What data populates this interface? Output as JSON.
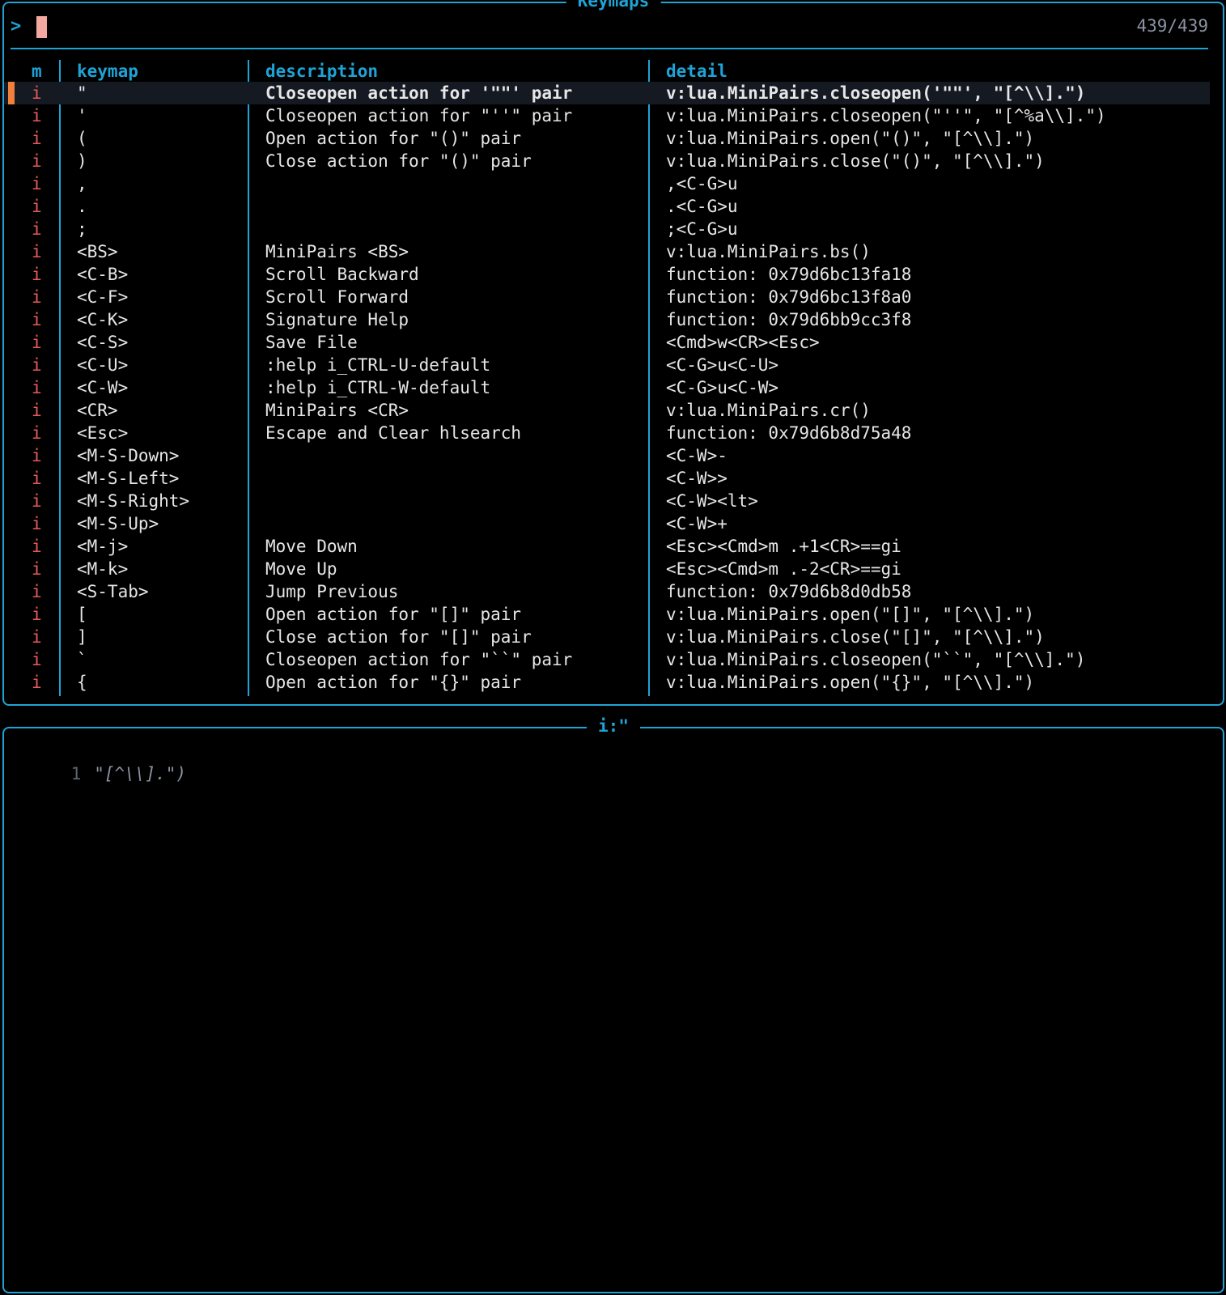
{
  "picker": {
    "title": "Keymaps",
    "prompt_symbol": ">",
    "query": "",
    "counter": "439/439",
    "columns": {
      "mode": "m",
      "keymap": "keymap",
      "description": "description",
      "detail": "detail"
    },
    "rows": [
      {
        "mode": "i",
        "keymap": "\"",
        "description": "Closeopen action for '\"\"' pair",
        "detail": "v:lua.MiniPairs.closeopen('\"\"', \"[^\\\\].\")",
        "selected": true
      },
      {
        "mode": "i",
        "keymap": "'",
        "description": "Closeopen action for \"''\" pair",
        "detail": "v:lua.MiniPairs.closeopen(\"''\", \"[^%a\\\\].\")"
      },
      {
        "mode": "i",
        "keymap": "(",
        "description": "Open action for \"()\" pair",
        "detail": "v:lua.MiniPairs.open(\"()\", \"[^\\\\].\")"
      },
      {
        "mode": "i",
        "keymap": ")",
        "description": "Close action for \"()\" pair",
        "detail": "v:lua.MiniPairs.close(\"()\", \"[^\\\\].\")"
      },
      {
        "mode": "i",
        "keymap": ",",
        "description": "",
        "detail": ",<C-G>u"
      },
      {
        "mode": "i",
        "keymap": ".",
        "description": "",
        "detail": ".<C-G>u"
      },
      {
        "mode": "i",
        "keymap": ";",
        "description": "",
        "detail": ";<C-G>u"
      },
      {
        "mode": "i",
        "keymap": "<BS>",
        "description": "MiniPairs <BS>",
        "detail": "v:lua.MiniPairs.bs()"
      },
      {
        "mode": "i",
        "keymap": "<C-B>",
        "description": "Scroll Backward",
        "detail": "function: 0x79d6bc13fa18"
      },
      {
        "mode": "i",
        "keymap": "<C-F>",
        "description": "Scroll Forward",
        "detail": "function: 0x79d6bc13f8a0"
      },
      {
        "mode": "i",
        "keymap": "<C-K>",
        "description": "Signature Help",
        "detail": "function: 0x79d6bb9cc3f8"
      },
      {
        "mode": "i",
        "keymap": "<C-S>",
        "description": "Save File",
        "detail": "<Cmd>w<CR><Esc>"
      },
      {
        "mode": "i",
        "keymap": "<C-U>",
        "description": ":help i_CTRL-U-default",
        "detail": "<C-G>u<C-U>"
      },
      {
        "mode": "i",
        "keymap": "<C-W>",
        "description": ":help i_CTRL-W-default",
        "detail": "<C-G>u<C-W>"
      },
      {
        "mode": "i",
        "keymap": "<CR>",
        "description": "MiniPairs <CR>",
        "detail": "v:lua.MiniPairs.cr()"
      },
      {
        "mode": "i",
        "keymap": "<Esc>",
        "description": "Escape and Clear hlsearch",
        "detail": "function: 0x79d6b8d75a48"
      },
      {
        "mode": "i",
        "keymap": "<M-S-Down>",
        "description": "",
        "detail": "<C-W>-"
      },
      {
        "mode": "i",
        "keymap": "<M-S-Left>",
        "description": "",
        "detail": "<C-W>>"
      },
      {
        "mode": "i",
        "keymap": "<M-S-Right>",
        "description": "",
        "detail": "<C-W><lt>"
      },
      {
        "mode": "i",
        "keymap": "<M-S-Up>",
        "description": "",
        "detail": "<C-W>+"
      },
      {
        "mode": "i",
        "keymap": "<M-j>",
        "description": "Move Down",
        "detail": "<Esc><Cmd>m .+1<CR>==gi"
      },
      {
        "mode": "i",
        "keymap": "<M-k>",
        "description": "Move Up",
        "detail": "<Esc><Cmd>m .-2<CR>==gi"
      },
      {
        "mode": "i",
        "keymap": "<S-Tab>",
        "description": "Jump Previous",
        "detail": "function: 0x79d6b8d0db58"
      },
      {
        "mode": "i",
        "keymap": "[",
        "description": "Open action for \"[]\" pair",
        "detail": "v:lua.MiniPairs.open(\"[]\", \"[^\\\\].\")"
      },
      {
        "mode": "i",
        "keymap": "]",
        "description": "Close action for \"[]\" pair",
        "detail": "v:lua.MiniPairs.close(\"[]\", \"[^\\\\].\")"
      },
      {
        "mode": "i",
        "keymap": "`",
        "description": "Closeopen action for \"``\" pair",
        "detail": "v:lua.MiniPairs.closeopen(\"``\", \"[^\\\\].\")"
      },
      {
        "mode": "i",
        "keymap": "{",
        "description": "Open action for \"{}\" pair",
        "detail": "v:lua.MiniPairs.open(\"{}\", \"[^\\\\].\")"
      }
    ]
  },
  "preview": {
    "title": "i:\"",
    "line_number": "1",
    "code": "\"[^\\\\].\")"
  },
  "colors": {
    "border": "#1fa3d6",
    "mode": "#e55b5b",
    "cursor": "#f4a9a0",
    "selection_marker": "#f0803c"
  }
}
